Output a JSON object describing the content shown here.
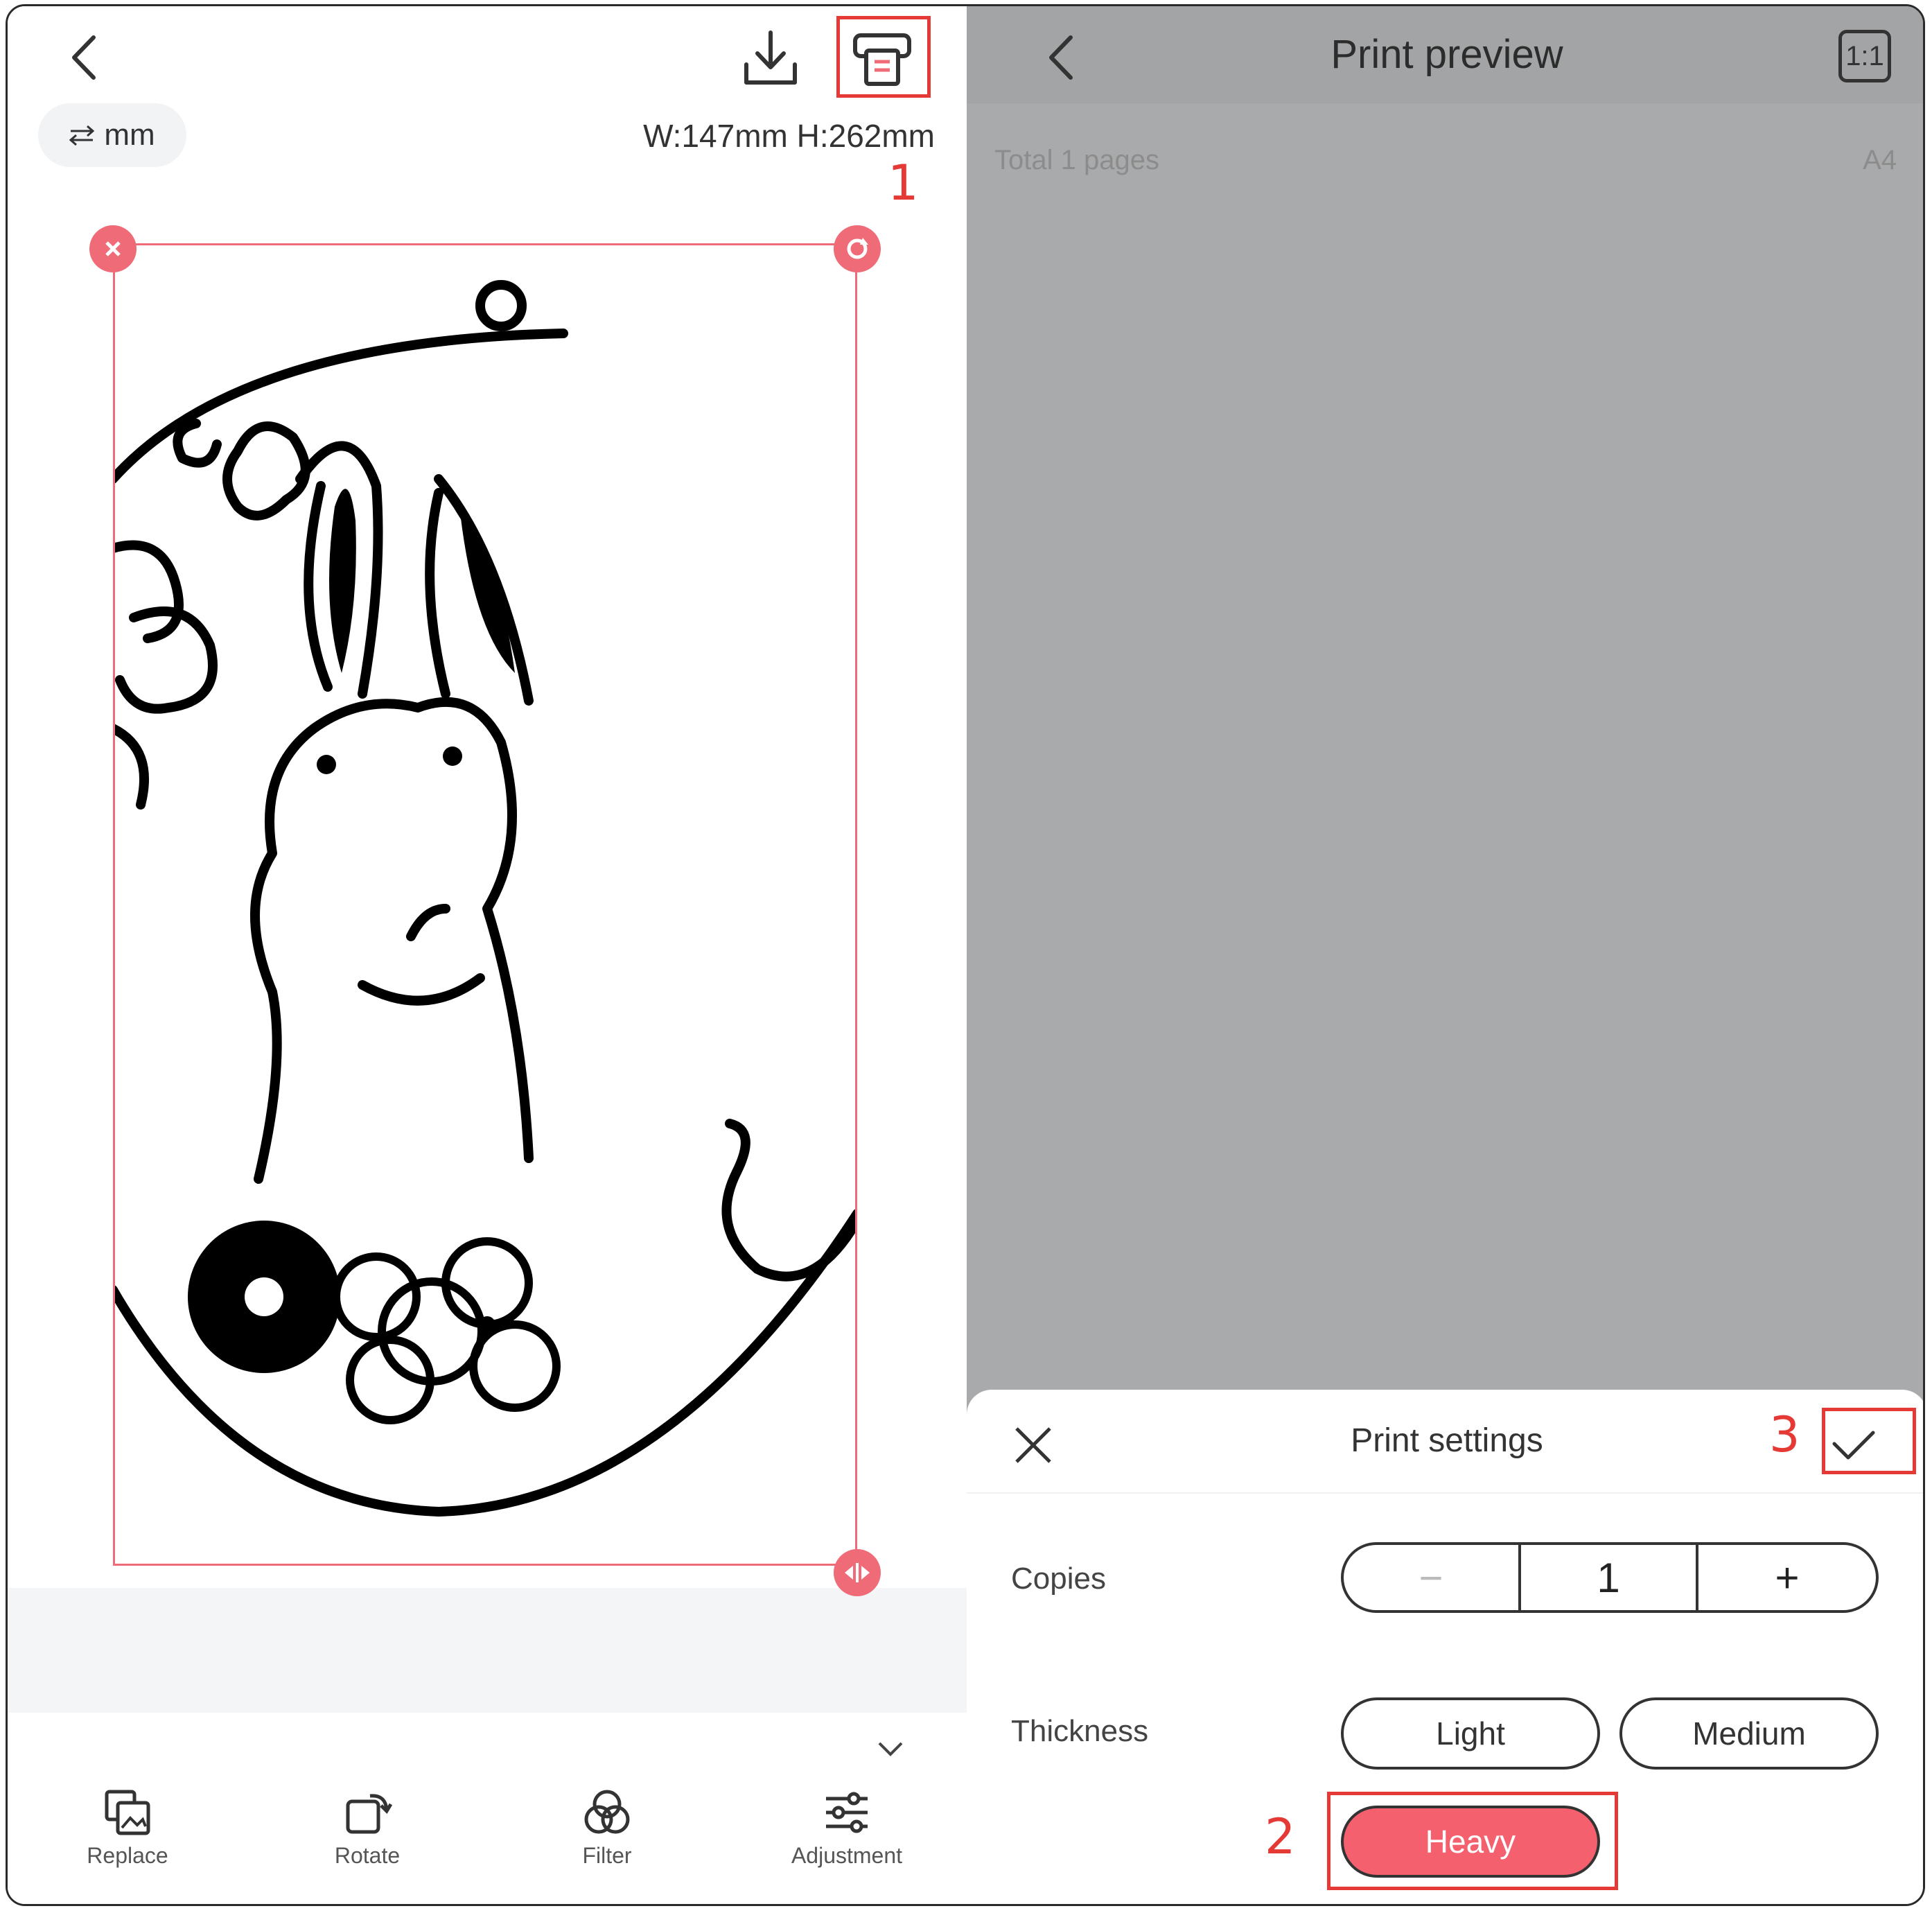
{
  "editor": {
    "unit_label": "mm",
    "dimensions": "W:147mm H:262mm",
    "toolbar": [
      {
        "label": "Replace",
        "icon": "replace-icon"
      },
      {
        "label": "Rotate",
        "icon": "rotate-icon"
      },
      {
        "label": "Filter",
        "icon": "filter-icon"
      },
      {
        "label": "Adjustment",
        "icon": "sliders-icon"
      }
    ]
  },
  "preview": {
    "title": "Print preview",
    "ratio_button": "1:1",
    "pages_label": "Total 1 pages",
    "paper_size": "A4"
  },
  "print_settings": {
    "title": "Print settings",
    "copies_label": "Copies",
    "copies_minus": "−",
    "copies_value": "1",
    "copies_plus": "+",
    "thickness_label": "Thickness",
    "thickness_options": [
      "Light",
      "Medium",
      "Heavy"
    ],
    "selected_thickness": "Heavy"
  },
  "annotations": {
    "step1": "1",
    "step2": "2",
    "step3": "3"
  },
  "colors": {
    "accent": "#f5606f",
    "annotation": "#e53935",
    "preview_bg": "#a9aaab"
  }
}
